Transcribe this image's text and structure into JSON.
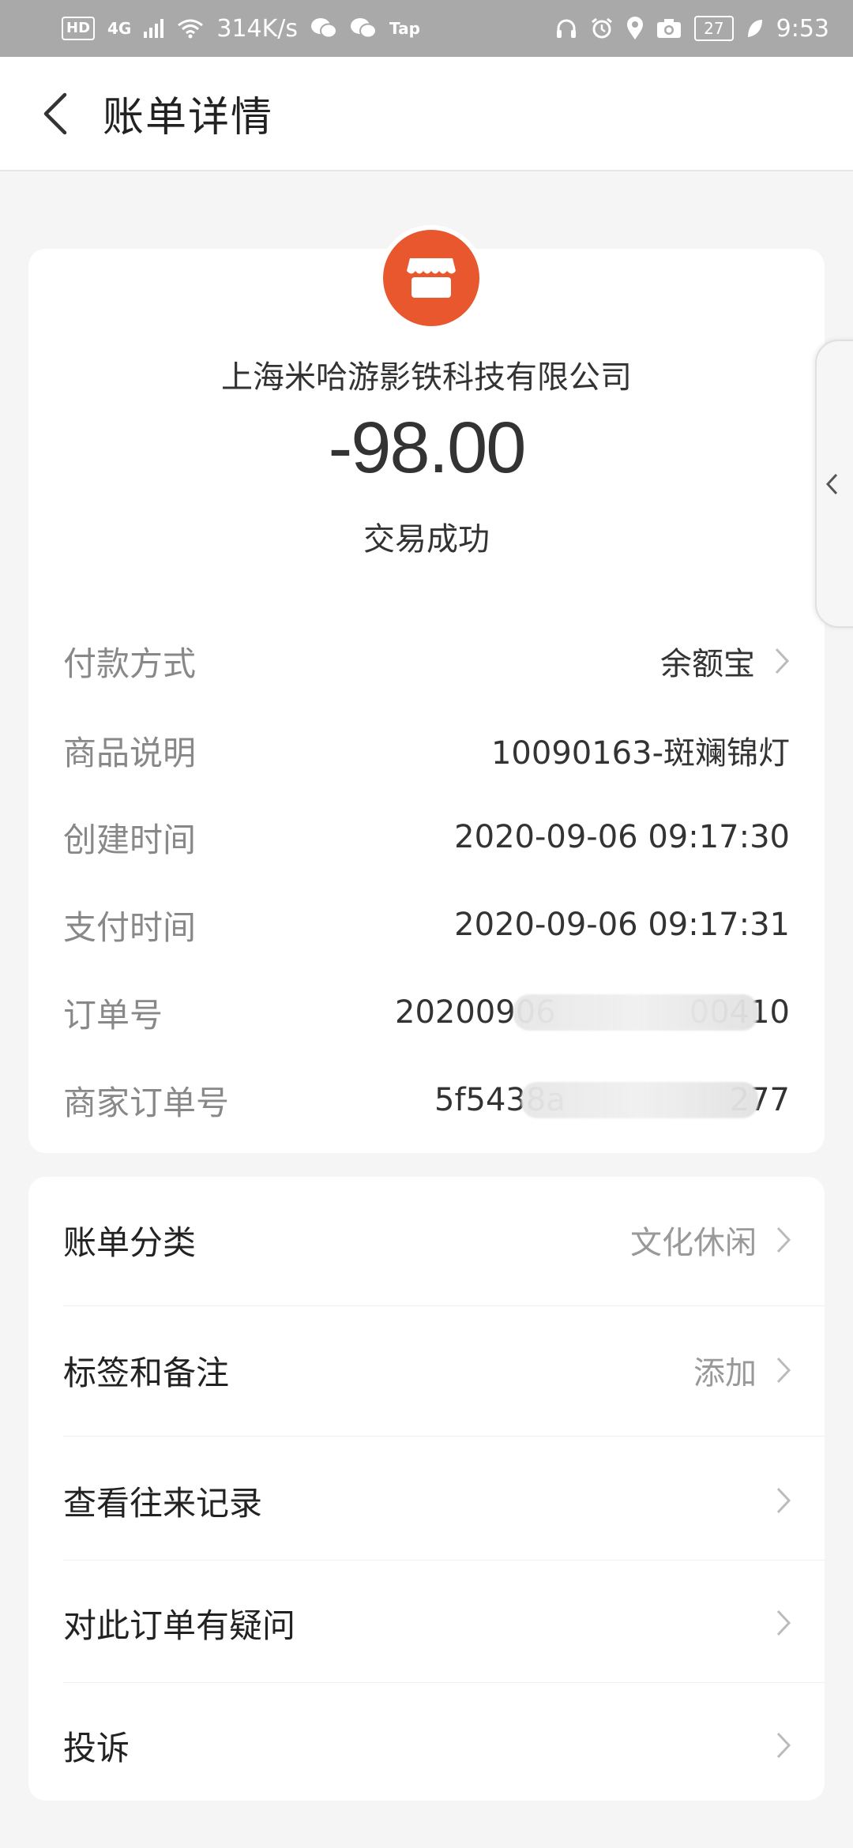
{
  "status_bar": {
    "hd": "HD",
    "network": "4G",
    "speed": "314K/s",
    "tap": "Tap",
    "battery": "27",
    "time": "9:53"
  },
  "header": {
    "title": "账单详情"
  },
  "transaction": {
    "merchant": "上海米哈游影铁科技有限公司",
    "amount": "-98.00",
    "status": "交易成功",
    "merchant_icon": "store-icon",
    "accent_color": "#e8572d"
  },
  "details": [
    {
      "label": "付款方式",
      "value": "余额宝"
    },
    {
      "label": "商品说明",
      "value": "10090163-斑斓锦灯"
    },
    {
      "label": "创建时间",
      "value": "2020-09-06 09:17:30"
    },
    {
      "label": "支付时间",
      "value": "2020-09-06 09:17:31"
    },
    {
      "label": "订单号",
      "value_prefix": "20200906",
      "value_suffix": "00410"
    },
    {
      "label": "商家订单号",
      "value_prefix": "5f5438a",
      "value_suffix": "277"
    }
  ],
  "actions": [
    {
      "label": "账单分类",
      "value": "文化休闲"
    },
    {
      "label": "标签和备注",
      "value": "添加"
    },
    {
      "label": "查看往来记录",
      "value": ""
    },
    {
      "label": "对此订单有疑问",
      "value": ""
    },
    {
      "label": "投诉",
      "value": ""
    }
  ]
}
